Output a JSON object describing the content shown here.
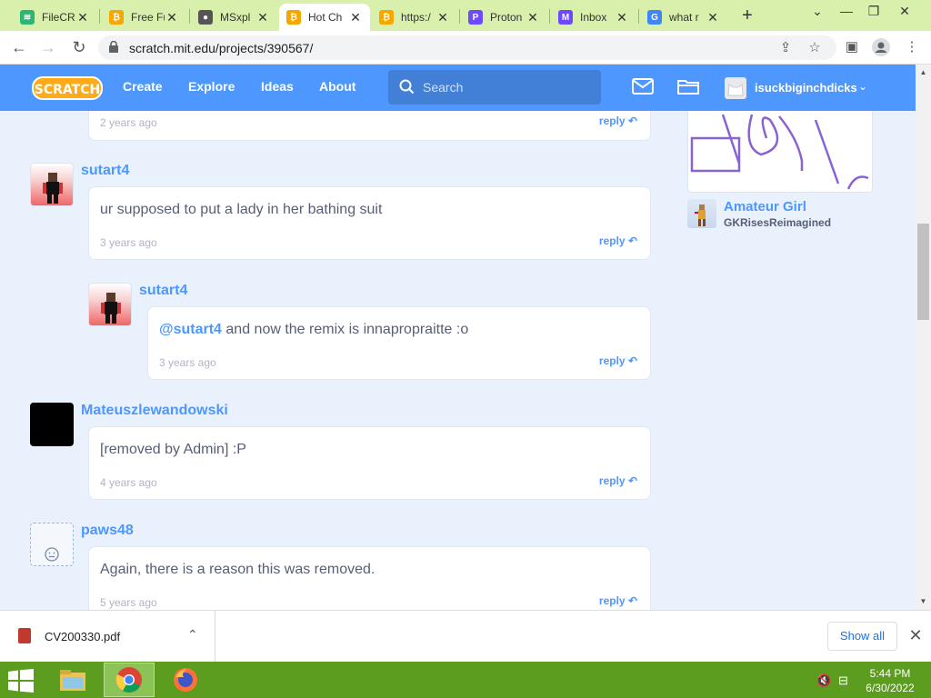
{
  "browser": {
    "tabs": [
      {
        "title": "FileCR",
        "favicon_color": "#2bb673",
        "favicon_glyph": "≋"
      },
      {
        "title": "Free Fu",
        "favicon_color": "#f7a600",
        "favicon_glyph": "₿"
      },
      {
        "title": "MSxpl",
        "favicon_color": "#555555",
        "favicon_glyph": "●"
      },
      {
        "title": "Hot Ch",
        "favicon_color": "#f7a600",
        "favicon_glyph": "₿"
      },
      {
        "title": "https:/",
        "favicon_color": "#f7a600",
        "favicon_glyph": "₿"
      },
      {
        "title": "Proton",
        "favicon_color": "#6d4aff",
        "favicon_glyph": "P"
      },
      {
        "title": "Inbox",
        "favicon_color": "#6d4aff",
        "favicon_glyph": "M"
      },
      {
        "title": "what r",
        "favicon_color": "#4285f4",
        "favicon_glyph": "G"
      }
    ],
    "active_tab_index": 3,
    "url": "scratch.mit.edu/projects/390567/"
  },
  "scratch_nav": {
    "logo": "SCRATCH",
    "links": [
      "Create",
      "Explore",
      "Ideas",
      "About"
    ],
    "search_placeholder": "Search",
    "username": "isuckbiginchdicks"
  },
  "comments": {
    "reply_label": "reply",
    "top_partial": {
      "time": "2 years ago"
    },
    "c1": {
      "user": "sutart4",
      "text": "ur supposed to put a lady in her bathing suit",
      "time": "3 years ago"
    },
    "c1_reply": {
      "user": "sutart4",
      "mention": "@sutart4",
      "text": " and now the remix is innapropraitte :o",
      "time": "3 years ago"
    },
    "c2": {
      "user": "Mateuszlewandowski",
      "text": "[removed by Admin] :P",
      "time": "4 years ago"
    },
    "c3": {
      "user": "paws48",
      "text": "Again, there is a reason this was removed.",
      "time": "5 years ago"
    }
  },
  "sidebar": {
    "project_title": "Amateur Girl",
    "project_author": "GKRisesReimagined"
  },
  "download_bar": {
    "file_name": "CV200330.pdf",
    "show_all": "Show all"
  },
  "taskbar": {
    "time": "5:44 PM",
    "date": "6/30/2022"
  }
}
